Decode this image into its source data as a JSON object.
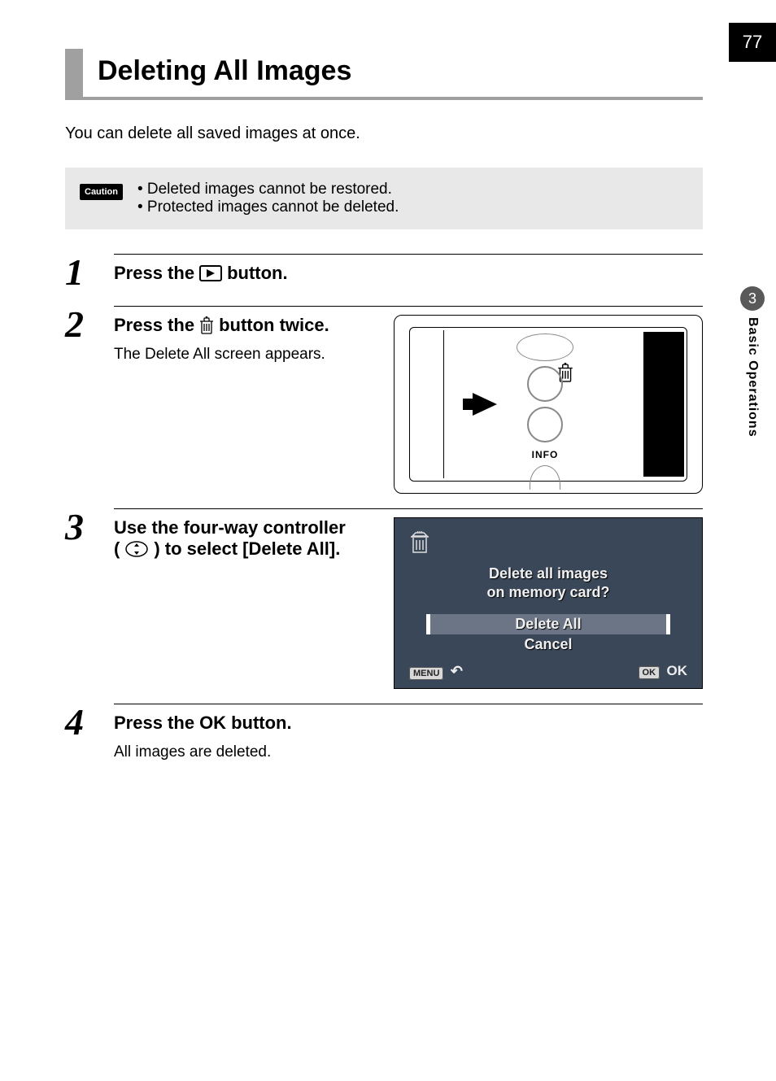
{
  "page_number": "77",
  "chapter": {
    "number": "3",
    "title": "Basic Operations"
  },
  "heading": "Deleting All Images",
  "intro": "You can delete all saved images at once.",
  "caution": {
    "label": "Caution",
    "items": [
      "Deleted images cannot be restored.",
      "Protected images cannot be deleted."
    ]
  },
  "steps": {
    "s1": {
      "num": "1",
      "title_before": "Press the",
      "title_after": "button."
    },
    "s2": {
      "num": "2",
      "title_before": "Press the",
      "title_after": "button twice.",
      "desc": "The Delete All screen appears.",
      "diagram": {
        "info_label": "INFO"
      }
    },
    "s3": {
      "num": "3",
      "title_line1_before": "Use the four-way controller",
      "title_line2_before": "(",
      "title_line2_after": ") to select [Delete All].",
      "lcd": {
        "msg_line1": "Delete all images",
        "msg_line2": "on memory card?",
        "option_delete": "Delete All",
        "option_cancel": "Cancel",
        "menu_label": "MENU",
        "ok_badge": "OK",
        "ok_label": "OK"
      }
    },
    "s4": {
      "num": "4",
      "title_before": "Press the",
      "ok_text": "OK",
      "title_after": "button.",
      "desc": "All images are deleted."
    }
  }
}
